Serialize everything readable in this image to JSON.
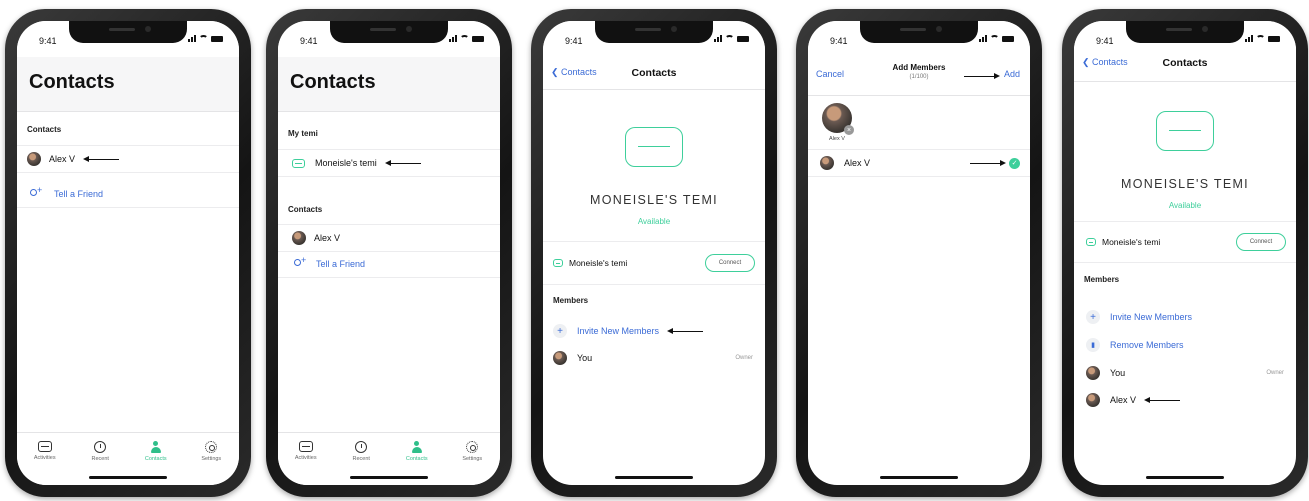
{
  "status_time": "9:41",
  "tabs": [
    "Activities",
    "Recent",
    "Contacts",
    "Settings"
  ],
  "screen1": {
    "title": "Contacts",
    "section": "Contacts",
    "contact": "Alex V",
    "tell_friend": "Tell a Friend"
  },
  "screen2": {
    "title": "Contacts",
    "my_temi_section": "My temi",
    "temi_item": "Moneisle's temi",
    "contacts_section": "Contacts",
    "contact": "Alex V",
    "tell_friend": "Tell a Friend"
  },
  "screen3": {
    "back": "Contacts",
    "title": "Contacts",
    "temi_name": "MONEISLE'S TEMI",
    "status": "Available",
    "temi_item": "Moneisle's temi",
    "connect": "Connect",
    "members_section": "Members",
    "invite": "Invite New Members",
    "you": "You",
    "owner": "Owner"
  },
  "screen4": {
    "cancel": "Cancel",
    "title": "Add Members",
    "count": "(1/100)",
    "add": "Add",
    "selected_name": "Alex V",
    "contact": "Alex V"
  },
  "screen5": {
    "back": "Contacts",
    "title": "Contacts",
    "temi_name": "MONEISLE'S TEMI",
    "status": "Available",
    "temi_item": "Moneisle's temi",
    "connect": "Connect",
    "members_section": "Members",
    "invite": "Invite New Members",
    "remove": "Remove Members",
    "you": "You",
    "owner": "Owner",
    "contact": "Alex V"
  }
}
